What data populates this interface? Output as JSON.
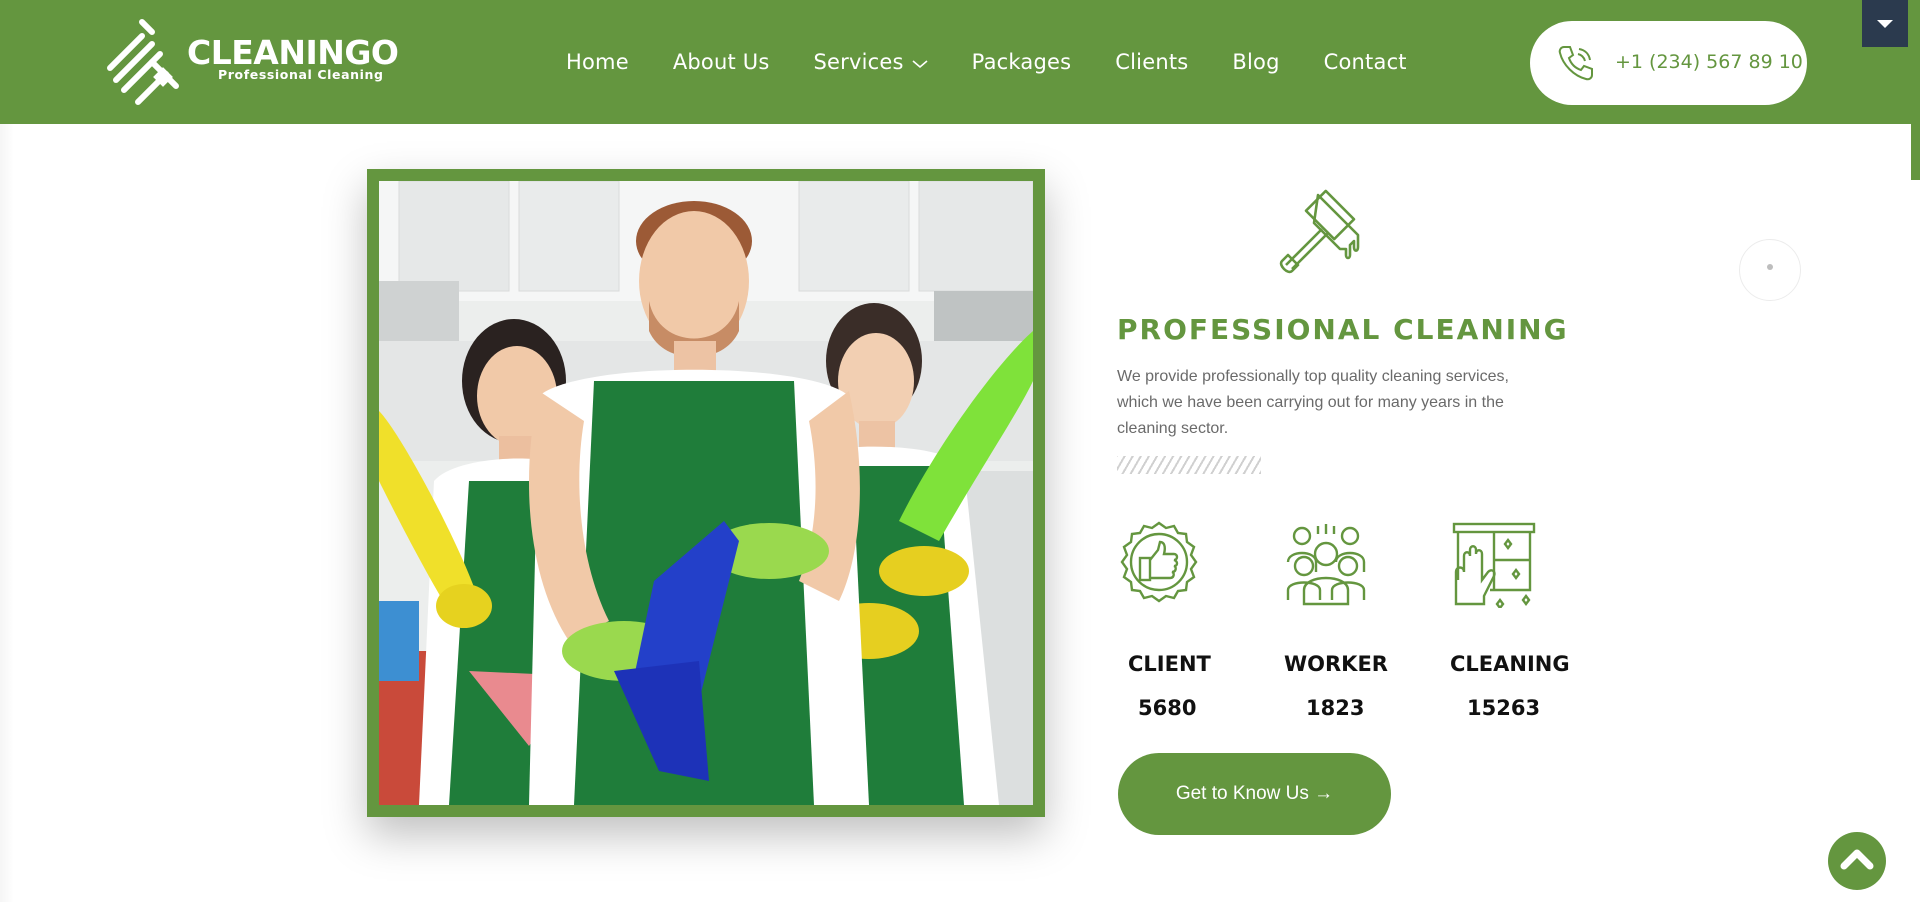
{
  "brand": {
    "name": "CLEANINGO",
    "tagline": "Professional Cleaning"
  },
  "nav": {
    "items": [
      {
        "label": "Home"
      },
      {
        "label": "About Us"
      },
      {
        "label": "Services"
      },
      {
        "label": "Packages"
      },
      {
        "label": "Clients"
      },
      {
        "label": "Blog"
      },
      {
        "label": "Contact"
      }
    ],
    "services_icon": "chevron-down-icon"
  },
  "contact": {
    "phone": "+1 (234) 567 89 10",
    "icon": "phone-icon"
  },
  "hero": {
    "title": "PROFESSIONAL CLEANING",
    "description": "We provide professionally top quality cleaning services, which we have been carrying out for many years in the cleaning sector.",
    "icon": "squeegee-icon"
  },
  "stats": [
    {
      "label": "CLIENT",
      "value": "5680",
      "icon": "thumbs-up-badge-icon"
    },
    {
      "label": "WORKER",
      "value": "1823",
      "icon": "team-icon"
    },
    {
      "label": "CLEANING",
      "value": "15263",
      "icon": "glove-cleaning-icon"
    }
  ],
  "cta": {
    "label": "Get to Know Us →"
  },
  "colors": {
    "primary": "#64963f",
    "dark_toggle": "#2b3a4e",
    "text_dark": "#111111",
    "text_muted": "#6a6a6a"
  }
}
